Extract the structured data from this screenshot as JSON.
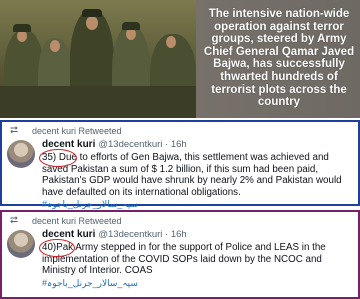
{
  "banner": {
    "text": "The intensive nation-wide operation against terror groups, steered by Army Chief General Qamar Javed Bajwa, has successfully thwarted hundreds of terrorist plots across the country"
  },
  "tweets": [
    {
      "retweet_label": "decent kuri Retweeted",
      "name": "decent kuri",
      "handle": "@13decentkuri · 16h",
      "number": "35)",
      "word": "Due",
      "body_rest": " to efforts of Gen Bajwa, this settlement was achieved and saved Pakistan a sum of $ 1.2 billion, if this sum had been paid, Pakistan's GDP would have shrunk by nearly 2% and Pakistan would have defaulted on its international obligations.",
      "hashtag": "#سپہ_سالار_جرنل_باجوہ"
    },
    {
      "retweet_label": "decent kuri Retweeted",
      "name": "decent kuri",
      "handle": "@13decentkuri · 16h",
      "number": "40)",
      "word": "Pak",
      "body_rest": " Army stepped in for the support of Police and LEAS in the implementation of the COVID SOPs laid down by the NCOC and Ministry of Interior. COAS",
      "hashtag": "#سپہ_سالار_جرنل_باجوہ"
    }
  ],
  "colors": {
    "tweet1_border": "#1e3f9e",
    "tweet2_border": "#7a1f6a",
    "annotation_circle": "#d0212b",
    "hashtag": "#1d6fc2"
  }
}
